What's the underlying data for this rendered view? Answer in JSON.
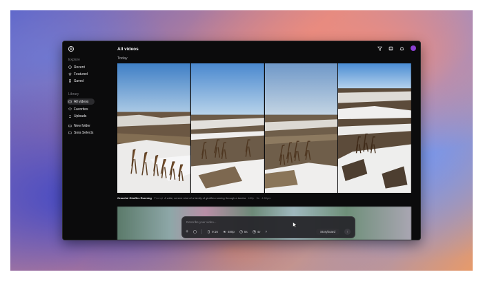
{
  "sidebar": {
    "explore_label": "Explore",
    "explore_items": [
      {
        "label": "Recent",
        "icon": "clock-icon"
      },
      {
        "label": "Featured",
        "icon": "star-icon"
      },
      {
        "label": "Saved",
        "icon": "bookmark-icon"
      }
    ],
    "library_label": "Library",
    "library_items": [
      {
        "label": "All videos",
        "icon": "library-icon",
        "active": true
      },
      {
        "label": "Favorites",
        "icon": "heart-icon"
      },
      {
        "label": "Uploads",
        "icon": "upload-icon"
      },
      {
        "label": "New folder",
        "icon": "folder-plus-icon"
      },
      {
        "label": "Sora Selects",
        "icon": "folder-icon"
      }
    ]
  },
  "header": {
    "title": "All videos",
    "icons": [
      "filter-icon",
      "layers-icon",
      "bell-icon",
      "avatar"
    ],
    "avatar_color": "#8a3fd1"
  },
  "section": {
    "label": "Today"
  },
  "caption": {
    "name": "Graceful Giraffes Running",
    "prompt_tag": "Prompt",
    "prompt": "A wide, serene shot of a family of giraffes running through a tundra",
    "resolution": "480p",
    "duration": "5s",
    "time": "4:50pm"
  },
  "composer": {
    "placeholder": "Describe your video...",
    "aspect": "9:16",
    "quality": "480p",
    "duration": "5s",
    "variations": "4v",
    "help": "?",
    "storyboard": "Storyboard"
  },
  "colors": {
    "background": "#0b0b0c",
    "active_item": "#2b2b2e",
    "text": "#f2f2f4"
  }
}
